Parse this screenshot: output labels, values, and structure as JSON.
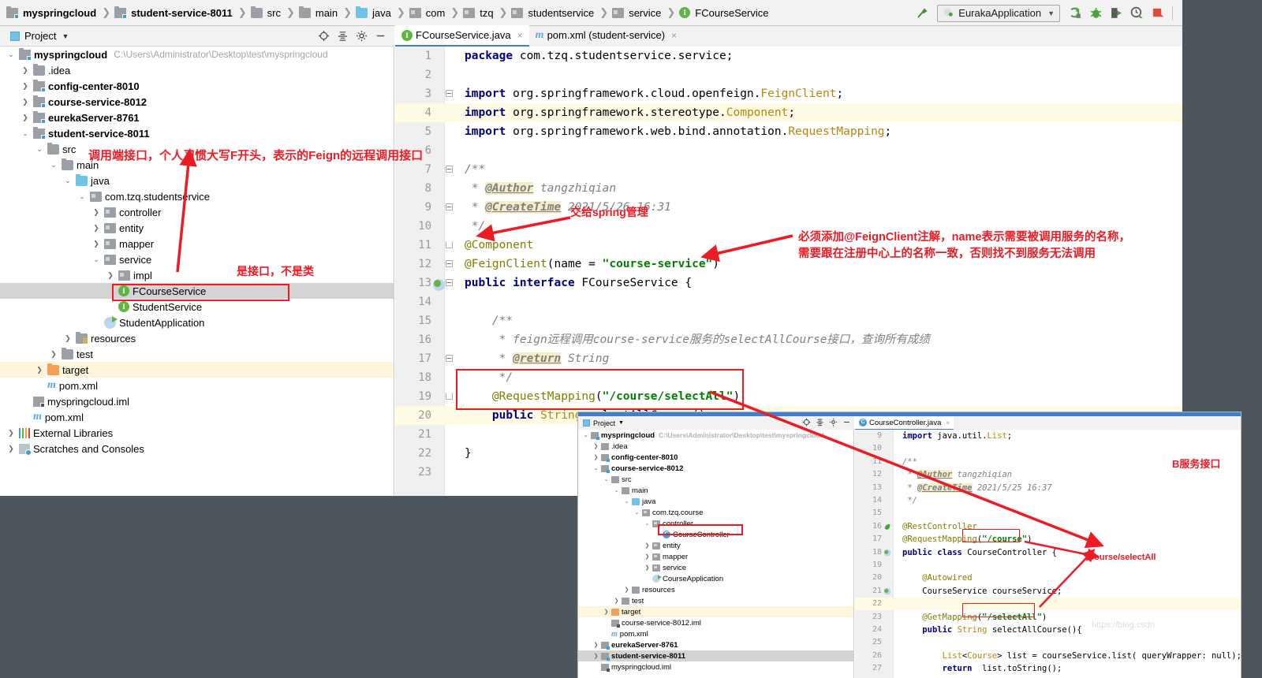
{
  "window": {
    "breadcrumb": [
      {
        "label": "myspringcloud",
        "icon": "module-icon",
        "bold": true
      },
      {
        "label": "student-service-8011",
        "icon": "module-icon",
        "bold": true
      },
      {
        "label": "src",
        "icon": "folder-icon",
        "bold": false
      },
      {
        "label": "main",
        "icon": "folder-icon",
        "bold": false
      },
      {
        "label": "java",
        "icon": "source-folder-icon",
        "bold": false
      },
      {
        "label": "com",
        "icon": "package-icon",
        "bold": false
      },
      {
        "label": "tzq",
        "icon": "package-icon",
        "bold": false
      },
      {
        "label": "studentservice",
        "icon": "package-icon",
        "bold": false
      },
      {
        "label": "service",
        "icon": "package-icon",
        "bold": false
      },
      {
        "label": "FCourseService",
        "icon": "interface-icon",
        "bold": false
      }
    ],
    "toolbar": {
      "run_config": "EurakaApplication",
      "icons": [
        "build-hammer-icon",
        "run-icon",
        "debug-icon",
        "run-with-coverage-icon",
        "profiler-icon",
        "stop-icon"
      ]
    }
  },
  "project_panel": {
    "title": "Project",
    "icons": [
      "locate-icon",
      "collapse-all-icon",
      "settings-gear-icon",
      "hide-icon"
    ],
    "tree": [
      {
        "depth": 0,
        "label": "myspringcloud",
        "path": "C:\\Users\\Administrator\\Desktop\\test\\myspringcloud",
        "arrow": "v",
        "icon": "module-icon",
        "bold": true
      },
      {
        "depth": 1,
        "label": ".idea",
        "arrow": ">",
        "icon": "folder-icon",
        "bold": false
      },
      {
        "depth": 1,
        "label": "config-center-8010",
        "arrow": ">",
        "icon": "module-icon",
        "bold": true
      },
      {
        "depth": 1,
        "label": "course-service-8012",
        "arrow": ">",
        "icon": "module-icon",
        "bold": true
      },
      {
        "depth": 1,
        "label": "eurekaServer-8761",
        "arrow": ">",
        "icon": "module-icon",
        "bold": true
      },
      {
        "depth": 1,
        "label": "student-service-8011",
        "arrow": "v",
        "icon": "module-icon",
        "bold": true
      },
      {
        "depth": 2,
        "label": "src",
        "arrow": "v",
        "icon": "folder-icon",
        "bold": false
      },
      {
        "depth": 3,
        "label": "main",
        "arrow": "v",
        "icon": "folder-icon",
        "bold": false
      },
      {
        "depth": 4,
        "label": "java",
        "arrow": "v",
        "icon": "source-folder-icon",
        "bold": false
      },
      {
        "depth": 5,
        "label": "com.tzq.studentservice",
        "arrow": "v",
        "icon": "package-icon",
        "bold": false
      },
      {
        "depth": 6,
        "label": "controller",
        "arrow": ">",
        "icon": "package-icon",
        "bold": false
      },
      {
        "depth": 6,
        "label": "entity",
        "arrow": ">",
        "icon": "package-icon",
        "bold": false
      },
      {
        "depth": 6,
        "label": "mapper",
        "arrow": ">",
        "icon": "package-icon",
        "bold": false
      },
      {
        "depth": 6,
        "label": "service",
        "arrow": "v",
        "icon": "package-icon",
        "bold": false
      },
      {
        "depth": 7,
        "label": "impl",
        "arrow": ">",
        "icon": "package-icon",
        "bold": false
      },
      {
        "depth": 7,
        "label": "FCourseService",
        "arrow": "",
        "icon": "interface-icon",
        "bold": false,
        "selected": true
      },
      {
        "depth": 7,
        "label": "StudentService",
        "arrow": "",
        "icon": "interface-icon",
        "bold": false
      },
      {
        "depth": 6,
        "label": "StudentApplication",
        "arrow": "",
        "icon": "run-class-icon",
        "bold": false
      },
      {
        "depth": 4,
        "label": "resources",
        "arrow": ">",
        "icon": "resources-folder-icon",
        "bold": false
      },
      {
        "depth": 3,
        "label": "test",
        "arrow": ">",
        "icon": "folder-icon",
        "bold": false
      },
      {
        "depth": 2,
        "label": "target",
        "arrow": ">",
        "icon": "target-folder-icon",
        "bold": false,
        "highlight": true
      },
      {
        "depth": 2,
        "label": "pom.xml",
        "arrow": "",
        "icon": "maven-icon",
        "bold": false
      },
      {
        "depth": 1,
        "label": "myspringcloud.iml",
        "arrow": "",
        "icon": "iml-icon",
        "bold": false
      },
      {
        "depth": 1,
        "label": "pom.xml",
        "arrow": "",
        "icon": "maven-icon",
        "bold": false
      },
      {
        "depth": 0,
        "label": "External Libraries",
        "arrow": ">",
        "icon": "libraries-icon",
        "bold": false
      },
      {
        "depth": 0,
        "label": "Scratches and Consoles",
        "arrow": ">",
        "icon": "scratches-icon",
        "bold": false
      }
    ]
  },
  "editor": {
    "tabs": [
      {
        "label": "FCourseService.java",
        "icon": "interface-icon",
        "active": true,
        "close": "×"
      },
      {
        "label": "pom.xml (student-service)",
        "icon": "maven-icon",
        "active": false,
        "close": "×"
      }
    ],
    "line_numbers": [
      "1",
      "2",
      "3",
      "4",
      "5",
      "6",
      "7",
      "8",
      "9",
      "10",
      "11",
      "12",
      "13",
      "14",
      "15",
      "16",
      "17",
      "18",
      "19",
      "20",
      "21",
      "22",
      "23"
    ],
    "lines": [
      "package com.tzq.studentservice.service;",
      "",
      "import org.springframework.cloud.openfeign.FeignClient;",
      "import org.springframework.stereotype.Component;",
      "import org.springframework.web.bind.annotation.RequestMapping;",
      "",
      "/**",
      " * @Author tangzhiqian",
      " * @CreateTime 2021/5/26 16:31",
      " */",
      "@Component",
      "@FeignClient(name = \"course-service\")",
      "public interface FCourseService {",
      "",
      "    /**",
      "     * feign远程调用course-service服务的selectAllCourse接口，查询所有成绩",
      "     * @return String",
      "     */",
      "    @RequestMapping(\"/course/selectAll\")",
      "    public String selectAllCourse();",
      "",
      "}",
      ""
    ]
  },
  "inner_window": {
    "project_panel": {
      "title": "Project",
      "tree": [
        {
          "depth": 0,
          "label": "myspringcloud",
          "path": "C:\\Users\\Administrator\\Desktop\\test\\myspringcloud",
          "arrow": "v",
          "icon": "module-icon",
          "bold": true
        },
        {
          "depth": 1,
          "label": ".idea",
          "arrow": ">",
          "icon": "folder-icon",
          "bold": false
        },
        {
          "depth": 1,
          "label": "config-center-8010",
          "arrow": ">",
          "icon": "module-icon",
          "bold": true
        },
        {
          "depth": 1,
          "label": "course-service-8012",
          "arrow": "v",
          "icon": "module-icon",
          "bold": true
        },
        {
          "depth": 2,
          "label": "src",
          "arrow": "v",
          "icon": "folder-icon",
          "bold": false
        },
        {
          "depth": 3,
          "label": "main",
          "arrow": "v",
          "icon": "folder-icon",
          "bold": false
        },
        {
          "depth": 4,
          "label": "java",
          "arrow": "v",
          "icon": "source-folder-icon",
          "bold": false
        },
        {
          "depth": 5,
          "label": "com.tzq.course",
          "arrow": "v",
          "icon": "package-icon",
          "bold": false
        },
        {
          "depth": 6,
          "label": "controller",
          "arrow": "v",
          "icon": "package-icon",
          "bold": false
        },
        {
          "depth": 7,
          "label": "CourseController",
          "arrow": "",
          "icon": "class-icon",
          "bold": false,
          "boxed": true
        },
        {
          "depth": 6,
          "label": "entity",
          "arrow": ">",
          "icon": "package-icon",
          "bold": false
        },
        {
          "depth": 6,
          "label": "mapper",
          "arrow": ">",
          "icon": "package-icon",
          "bold": false
        },
        {
          "depth": 6,
          "label": "service",
          "arrow": ">",
          "icon": "package-icon",
          "bold": false
        },
        {
          "depth": 6,
          "label": "CourseApplication",
          "arrow": "",
          "icon": "run-class-icon",
          "bold": false
        },
        {
          "depth": 4,
          "label": "resources",
          "arrow": ">",
          "icon": "resources-folder-icon",
          "bold": false
        },
        {
          "depth": 3,
          "label": "test",
          "arrow": ">",
          "icon": "folder-icon",
          "bold": false
        },
        {
          "depth": 2,
          "label": "target",
          "arrow": ">",
          "icon": "target-folder-icon",
          "bold": false,
          "highlight": true
        },
        {
          "depth": 2,
          "label": "course-service-8012.iml",
          "arrow": "",
          "icon": "iml-icon",
          "bold": false
        },
        {
          "depth": 2,
          "label": "pom.xml",
          "arrow": "",
          "icon": "maven-icon",
          "bold": false
        },
        {
          "depth": 1,
          "label": "eurekaServer-8761",
          "arrow": ">",
          "icon": "module-icon",
          "bold": true
        },
        {
          "depth": 1,
          "label": "student-service-8011",
          "arrow": ">",
          "icon": "module-icon",
          "bold": true,
          "selected": true
        },
        {
          "depth": 1,
          "label": "myspringcloud.iml",
          "arrow": "",
          "icon": "iml-icon",
          "bold": false
        }
      ]
    },
    "editor": {
      "tab": {
        "label": "CourseController.java",
        "icon": "class-icon",
        "close": "×"
      },
      "line_numbers": [
        "9",
        "10",
        "11",
        "12",
        "13",
        "14",
        "15",
        "16",
        "17",
        "18",
        "19",
        "20",
        "21",
        "22",
        "23",
        "24",
        "25",
        "26",
        "27"
      ],
      "lines": [
        "import java.util.List;",
        "",
        "/**",
        " * @Author tangzhiqian",
        " * @CreateTime 2021/5/25 16:37",
        " */",
        "",
        "@RestController",
        "@RequestMapping(\"/course\")",
        "public class CourseController {",
        "",
        "    @Autowired",
        "    CourseService courseService;",
        "",
        "    @GetMapping(\"/selectAll\")",
        "    public String selectAllCourse(){",
        "",
        "        List<Course> list = courseService.list( queryWrapper: null);",
        "        return  list.toString();"
      ],
      "watermark": "https://blog.csdn"
    }
  },
  "annotations": [
    {
      "id": "ann-feign-interface",
      "text": "调用端接口，个人习惯大写F开头，表示的Feign的远程调用接口"
    },
    {
      "id": "ann-is-interface",
      "text": "是接口，不是类"
    },
    {
      "id": "ann-spring-managed",
      "text": "交给spring管理"
    },
    {
      "id": "ann-feignclient-1",
      "text": "必须添加@FeignClient注解，name表示需要被调用服务的名称，"
    },
    {
      "id": "ann-feignclient-2",
      "text": "需要跟在注册中心上的名称一致，否则找不到服务无法调用"
    },
    {
      "id": "ann-b-service",
      "text": "B服务接口"
    },
    {
      "id": "ann-path",
      "text": "/course/selectAll"
    }
  ],
  "colors": {
    "annotation_red": "#ec1b24",
    "desktop": "#4e565d",
    "selection": "#d4d4d4",
    "highlight_row": "#fffae3",
    "accent_blue": "#3f7fd0",
    "interface_green": "#62b543",
    "class_blue": "#3f9ed6"
  }
}
